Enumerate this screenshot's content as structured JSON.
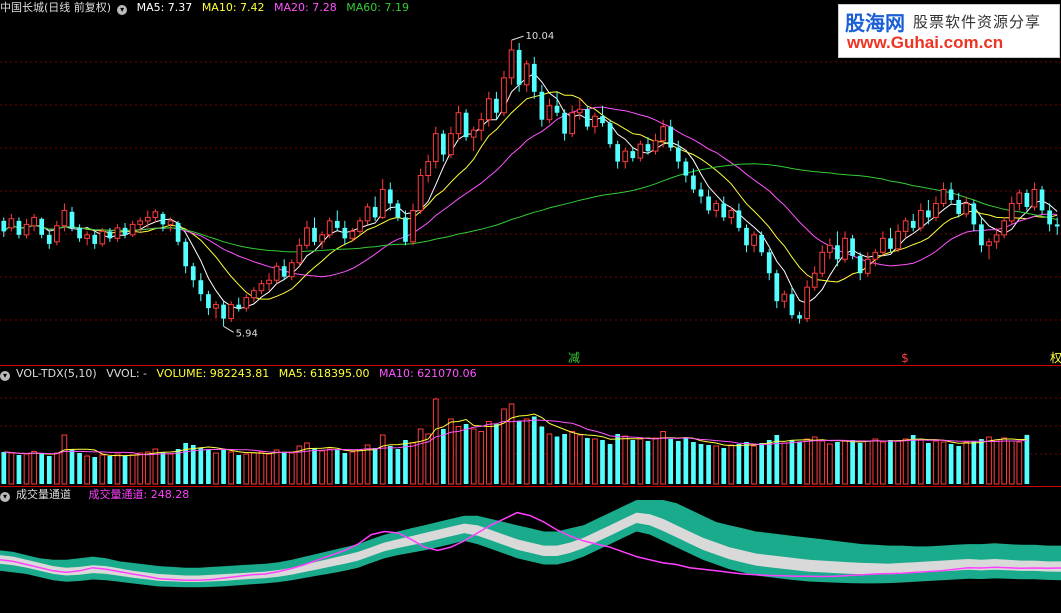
{
  "main_header": {
    "symbol": "中国长城(日线 前复权)",
    "ma5": "MA5: 7.37",
    "ma10": "MA10: 7.42",
    "ma20": "MA20: 7.28",
    "ma60": "MA60: 7.19"
  },
  "vol_header": {
    "name": "VOL-TDX(5,10)",
    "vvol": "VVOL: -",
    "volume": "VOLUME: 982243.81",
    "ma5": "MA5: 618395.00",
    "ma10": "MA10: 621070.06"
  },
  "ind_header": {
    "name": "成交量通道",
    "value": "成交量通道: 248.28"
  },
  "watermark": {
    "brand": "股海网",
    "slogan": "股票软件资源分享",
    "url": "www.Guhai.com.cn"
  },
  "markers": {
    "high": "10.04",
    "low": "5.94",
    "m1": "减",
    "m2": "$",
    "m3": "权"
  },
  "colors": {
    "up": "#ff3c3c",
    "down": "#54ffff",
    "ma5": "#ffffff",
    "ma10": "#ffff3c",
    "ma20": "#ff54ff",
    "ma60": "#33cc33",
    "band": "#1aaa8c",
    "band_inner": "#d9d9d9",
    "ind_line": "#ff40ff",
    "separator": "#c00000"
  },
  "chart_data": {
    "type": "candlestick",
    "price_ylim": [
      5.6,
      10.3
    ],
    "volume_ymax": 2000000,
    "channel_ymax": 680,
    "ohlc": [
      [
        7.45,
        7.5,
        7.22,
        7.3
      ],
      [
        7.35,
        7.55,
        7.3,
        7.48
      ],
      [
        7.45,
        7.5,
        7.2,
        7.25
      ],
      [
        7.25,
        7.48,
        7.2,
        7.4
      ],
      [
        7.38,
        7.55,
        7.3,
        7.5
      ],
      [
        7.48,
        7.5,
        7.2,
        7.25
      ],
      [
        7.25,
        7.3,
        7.05,
        7.12
      ],
      [
        7.15,
        7.45,
        7.1,
        7.38
      ],
      [
        7.38,
        7.7,
        7.3,
        7.6
      ],
      [
        7.58,
        7.65,
        7.3,
        7.35
      ],
      [
        7.35,
        7.4,
        7.15,
        7.2
      ],
      [
        7.2,
        7.3,
        7.1,
        7.25
      ],
      [
        7.25,
        7.3,
        7.05,
        7.12
      ],
      [
        7.12,
        7.35,
        7.08,
        7.3
      ],
      [
        7.3,
        7.35,
        7.15,
        7.2
      ],
      [
        7.2,
        7.4,
        7.15,
        7.35
      ],
      [
        7.35,
        7.42,
        7.2,
        7.25
      ],
      [
        7.25,
        7.45,
        7.22,
        7.4
      ],
      [
        7.4,
        7.5,
        7.3,
        7.45
      ],
      [
        7.45,
        7.6,
        7.35,
        7.5
      ],
      [
        7.5,
        7.62,
        7.42,
        7.58
      ],
      [
        7.55,
        7.58,
        7.3,
        7.4
      ],
      [
        7.4,
        7.5,
        7.3,
        7.45
      ],
      [
        7.42,
        7.45,
        7.1,
        7.15
      ],
      [
        7.15,
        7.2,
        6.7,
        6.8
      ],
      [
        6.8,
        6.85,
        6.5,
        6.6
      ],
      [
        6.6,
        6.7,
        6.3,
        6.4
      ],
      [
        6.4,
        6.45,
        6.1,
        6.2
      ],
      [
        6.2,
        6.3,
        6.05,
        6.25
      ],
      [
        6.25,
        6.3,
        5.94,
        6.05
      ],
      [
        6.05,
        6.3,
        6.0,
        6.25
      ],
      [
        6.25,
        6.35,
        6.15,
        6.2
      ],
      [
        6.2,
        6.4,
        6.15,
        6.35
      ],
      [
        6.35,
        6.5,
        6.28,
        6.45
      ],
      [
        6.45,
        6.6,
        6.4,
        6.55
      ],
      [
        6.55,
        6.7,
        6.45,
        6.6
      ],
      [
        6.6,
        6.85,
        6.55,
        6.8
      ],
      [
        6.8,
        6.9,
        6.6,
        6.65
      ],
      [
        6.65,
        6.9,
        6.6,
        6.85
      ],
      [
        6.85,
        7.2,
        6.8,
        7.1
      ],
      [
        7.1,
        7.45,
        7.05,
        7.35
      ],
      [
        7.35,
        7.5,
        7.1,
        7.15
      ],
      [
        7.15,
        7.3,
        7.05,
        7.25
      ],
      [
        7.25,
        7.5,
        7.2,
        7.45
      ],
      [
        7.45,
        7.6,
        7.3,
        7.35
      ],
      [
        7.35,
        7.45,
        7.1,
        7.2
      ],
      [
        7.2,
        7.35,
        7.15,
        7.3
      ],
      [
        7.3,
        7.5,
        7.25,
        7.45
      ],
      [
        7.45,
        7.7,
        7.4,
        7.65
      ],
      [
        7.65,
        7.8,
        7.45,
        7.5
      ],
      [
        7.5,
        8.05,
        7.48,
        7.9
      ],
      [
        7.9,
        8.0,
        7.6,
        7.7
      ],
      [
        7.7,
        7.75,
        7.45,
        7.5
      ],
      [
        7.5,
        7.6,
        7.1,
        7.15
      ],
      [
        7.15,
        7.7,
        7.1,
        7.6
      ],
      [
        7.6,
        8.2,
        7.55,
        8.1
      ],
      [
        8.1,
        8.4,
        8.0,
        8.3
      ],
      [
        8.3,
        8.8,
        8.2,
        8.7
      ],
      [
        8.7,
        8.75,
        8.3,
        8.4
      ],
      [
        8.4,
        8.8,
        8.35,
        8.7
      ],
      [
        8.7,
        9.1,
        8.6,
        9.0
      ],
      [
        9.0,
        9.05,
        8.6,
        8.65
      ],
      [
        8.65,
        8.8,
        8.45,
        8.75
      ],
      [
        8.75,
        9.0,
        8.6,
        8.9
      ],
      [
        8.9,
        9.3,
        8.8,
        9.2
      ],
      [
        9.2,
        9.3,
        8.9,
        9.0
      ],
      [
        9.0,
        9.6,
        8.95,
        9.5
      ],
      [
        9.5,
        10.04,
        9.4,
        9.9
      ],
      [
        9.9,
        10.0,
        9.3,
        9.4
      ],
      [
        9.4,
        9.75,
        9.3,
        9.7
      ],
      [
        9.7,
        9.8,
        9.2,
        9.3
      ],
      [
        9.3,
        9.4,
        8.8,
        8.9
      ],
      [
        8.9,
        9.2,
        8.85,
        9.1
      ],
      [
        9.1,
        9.3,
        8.95,
        9.0
      ],
      [
        9.0,
        9.05,
        8.6,
        8.7
      ],
      [
        8.7,
        9.1,
        8.65,
        9.0
      ],
      [
        9.0,
        9.2,
        8.9,
        9.05
      ],
      [
        9.05,
        9.1,
        8.75,
        8.8
      ],
      [
        8.8,
        9.0,
        8.7,
        8.95
      ],
      [
        8.95,
        9.1,
        8.8,
        8.85
      ],
      [
        8.85,
        8.9,
        8.5,
        8.55
      ],
      [
        8.55,
        8.6,
        8.2,
        8.3
      ],
      [
        8.3,
        8.5,
        8.2,
        8.45
      ],
      [
        8.45,
        8.5,
        8.3,
        8.35
      ],
      [
        8.35,
        8.6,
        8.3,
        8.55
      ],
      [
        8.55,
        8.65,
        8.4,
        8.45
      ],
      [
        8.45,
        8.7,
        8.4,
        8.6
      ],
      [
        8.6,
        8.9,
        8.5,
        8.8
      ],
      [
        8.8,
        8.9,
        8.45,
        8.5
      ],
      [
        8.5,
        8.6,
        8.2,
        8.3
      ],
      [
        8.3,
        8.35,
        8.0,
        8.1
      ],
      [
        8.1,
        8.2,
        7.85,
        7.9
      ],
      [
        7.9,
        8.0,
        7.7,
        7.8
      ],
      [
        7.8,
        7.9,
        7.55,
        7.6
      ],
      [
        7.6,
        7.75,
        7.5,
        7.7
      ],
      [
        7.7,
        7.8,
        7.45,
        7.5
      ],
      [
        7.5,
        7.65,
        7.4,
        7.6
      ],
      [
        7.6,
        7.7,
        7.3,
        7.35
      ],
      [
        7.35,
        7.4,
        7.0,
        7.1
      ],
      [
        7.1,
        7.3,
        7.0,
        7.25
      ],
      [
        7.25,
        7.3,
        6.95,
        7.0
      ],
      [
        7.0,
        7.05,
        6.6,
        6.7
      ],
      [
        6.7,
        6.75,
        6.2,
        6.3
      ],
      [
        6.3,
        6.45,
        6.2,
        6.4
      ],
      [
        6.4,
        6.5,
        6.05,
        6.1
      ],
      [
        6.1,
        6.15,
        5.98,
        6.05
      ],
      [
        6.05,
        6.6,
        6.0,
        6.5
      ],
      [
        6.5,
        6.8,
        6.45,
        6.7
      ],
      [
        6.7,
        7.1,
        6.65,
        7.0
      ],
      [
        7.0,
        7.2,
        6.9,
        7.1
      ],
      [
        7.1,
        7.3,
        6.8,
        6.9
      ],
      [
        6.9,
        7.3,
        6.85,
        7.2
      ],
      [
        7.2,
        7.25,
        6.9,
        6.95
      ],
      [
        6.95,
        7.0,
        6.6,
        6.7
      ],
      [
        6.7,
        7.0,
        6.65,
        6.9
      ],
      [
        6.9,
        7.05,
        6.8,
        7.0
      ],
      [
        7.0,
        7.3,
        6.95,
        7.2
      ],
      [
        7.2,
        7.35,
        7.0,
        7.05
      ],
      [
        7.05,
        7.4,
        7.0,
        7.3
      ],
      [
        7.3,
        7.5,
        7.2,
        7.45
      ],
      [
        7.45,
        7.55,
        7.3,
        7.35
      ],
      [
        7.35,
        7.7,
        7.3,
        7.6
      ],
      [
        7.6,
        7.75,
        7.4,
        7.5
      ],
      [
        7.5,
        7.8,
        7.45,
        7.7
      ],
      [
        7.7,
        8.0,
        7.65,
        7.9
      ],
      [
        7.9,
        8.0,
        7.7,
        7.75
      ],
      [
        7.75,
        7.85,
        7.5,
        7.55
      ],
      [
        7.55,
        7.8,
        7.5,
        7.7
      ],
      [
        7.7,
        7.75,
        7.3,
        7.4
      ],
      [
        7.4,
        7.5,
        7.0,
        7.1
      ],
      [
        7.1,
        7.2,
        6.9,
        7.15
      ],
      [
        7.15,
        7.35,
        7.05,
        7.25
      ],
      [
        7.25,
        7.5,
        7.2,
        7.45
      ],
      [
        7.45,
        7.8,
        7.4,
        7.7
      ],
      [
        7.7,
        7.9,
        7.6,
        7.85
      ],
      [
        7.85,
        7.9,
        7.6,
        7.65
      ],
      [
        7.65,
        8.0,
        7.6,
        7.9
      ],
      [
        7.9,
        7.95,
        7.55,
        7.6
      ],
      [
        7.6,
        7.7,
        7.3,
        7.4
      ],
      [
        7.4,
        7.5,
        7.25,
        7.37
      ]
    ],
    "volume": [
      640000,
      620000,
      580000,
      600000,
      650000,
      600000,
      560000,
      620000,
      980000,
      700000,
      620000,
      560000,
      540000,
      580000,
      560000,
      600000,
      560000,
      580000,
      620000,
      640000,
      700000,
      640000,
      600000,
      700000,
      820000,
      780000,
      720000,
      680000,
      620000,
      700000,
      640000,
      580000,
      600000,
      620000,
      640000,
      600000,
      680000,
      640000,
      620000,
      760000,
      820000,
      720000,
      660000,
      700000,
      680000,
      620000,
      640000,
      680000,
      780000,
      720000,
      980000,
      760000,
      700000,
      880000,
      820000,
      1100000,
      1000000,
      1700000,
      1100000,
      1300000,
      1150000,
      1200000,
      1100000,
      1050000,
      1250000,
      1200000,
      1500000,
      1600000,
      1250000,
      1300000,
      1350000,
      1150000,
      1000000,
      950000,
      1000000,
      1050000,
      980000,
      920000,
      900000,
      880000,
      800000,
      1000000,
      960000,
      880000,
      900000,
      860000,
      920000,
      1050000,
      900000,
      860000,
      920000,
      840000,
      800000,
      780000,
      760000,
      720000,
      780000,
      800000,
      840000,
      760000,
      820000,
      880000,
      980000,
      820000,
      880000,
      840000,
      900000,
      940000,
      860000,
      800000,
      840000,
      860000,
      880000,
      820000,
      860000,
      900000,
      840000,
      880000,
      860000,
      900000,
      980000,
      880000,
      820000,
      860000,
      840000,
      800000,
      760000,
      840000,
      860000,
      900000,
      940000,
      880000,
      920000,
      860000,
      840000,
      982244
    ],
    "channel_upper": [
      360,
      350,
      330,
      310,
      300,
      300,
      310,
      320,
      310,
      290,
      280,
      270,
      260,
      255,
      250,
      250,
      255,
      260,
      265,
      270,
      275,
      285,
      300,
      320,
      340,
      360,
      380,
      400,
      430,
      460,
      480,
      500,
      520,
      540,
      560,
      580,
      580,
      560,
      540,
      520,
      500,
      480,
      480,
      500,
      520,
      560,
      600,
      640,
      680,
      680,
      680,
      660,
      620,
      580,
      540,
      520,
      500,
      480,
      470,
      460,
      450,
      440,
      430,
      420,
      410,
      400,
      395,
      390,
      390,
      385,
      385,
      390,
      395,
      400,
      400,
      405,
      400,
      395,
      395,
      390,
      390
    ],
    "channel_inner": [
      330,
      320,
      300,
      280,
      260,
      250,
      255,
      265,
      260,
      245,
      230,
      220,
      210,
      205,
      200,
      200,
      205,
      210,
      215,
      220,
      225,
      235,
      250,
      270,
      290,
      310,
      330,
      350,
      380,
      410,
      430,
      450,
      470,
      490,
      510,
      530,
      520,
      490,
      460,
      430,
      410,
      390,
      390,
      410,
      440,
      480,
      520,
      560,
      600,
      590,
      560,
      520,
      480,
      440,
      410,
      380,
      360,
      340,
      330,
      320,
      310,
      300,
      295,
      290,
      285,
      280,
      278,
      275,
      280,
      285,
      290,
      295,
      300,
      305,
      300,
      305,
      300,
      295,
      295,
      290,
      290
    ],
    "channel_lower": [
      230,
      220,
      210,
      190,
      170,
      160,
      165,
      175,
      170,
      160,
      150,
      140,
      130,
      128,
      125,
      125,
      128,
      132,
      138,
      145,
      150,
      158,
      170,
      185,
      200,
      215,
      230,
      250,
      280,
      310,
      330,
      345,
      360,
      380,
      400,
      420,
      400,
      370,
      340,
      310,
      290,
      270,
      270,
      290,
      320,
      360,
      400,
      440,
      480,
      460,
      420,
      380,
      340,
      300,
      270,
      240,
      220,
      200,
      190,
      180,
      170,
      162,
      158,
      155,
      152,
      150,
      150,
      152,
      156,
      160,
      165,
      170,
      175,
      180,
      178,
      182,
      180,
      176,
      176,
      172,
      170
    ],
    "channel_line": [
      300,
      290,
      270,
      250,
      230,
      220,
      230,
      250,
      240,
      225,
      210,
      195,
      180,
      175,
      170,
      170,
      175,
      185,
      195,
      205,
      210,
      225,
      245,
      270,
      300,
      330,
      360,
      400,
      460,
      480,
      470,
      430,
      380,
      360,
      380,
      420,
      470,
      520,
      560,
      600,
      580,
      540,
      490,
      450,
      420,
      400,
      380,
      350,
      320,
      300,
      280,
      270,
      250,
      240,
      230,
      220,
      210,
      205,
      200,
      198,
      196,
      195,
      194,
      195,
      200,
      205,
      210,
      212,
      215,
      220,
      225,
      230,
      240,
      250,
      248,
      252,
      250,
      246,
      248,
      246,
      248
    ]
  }
}
